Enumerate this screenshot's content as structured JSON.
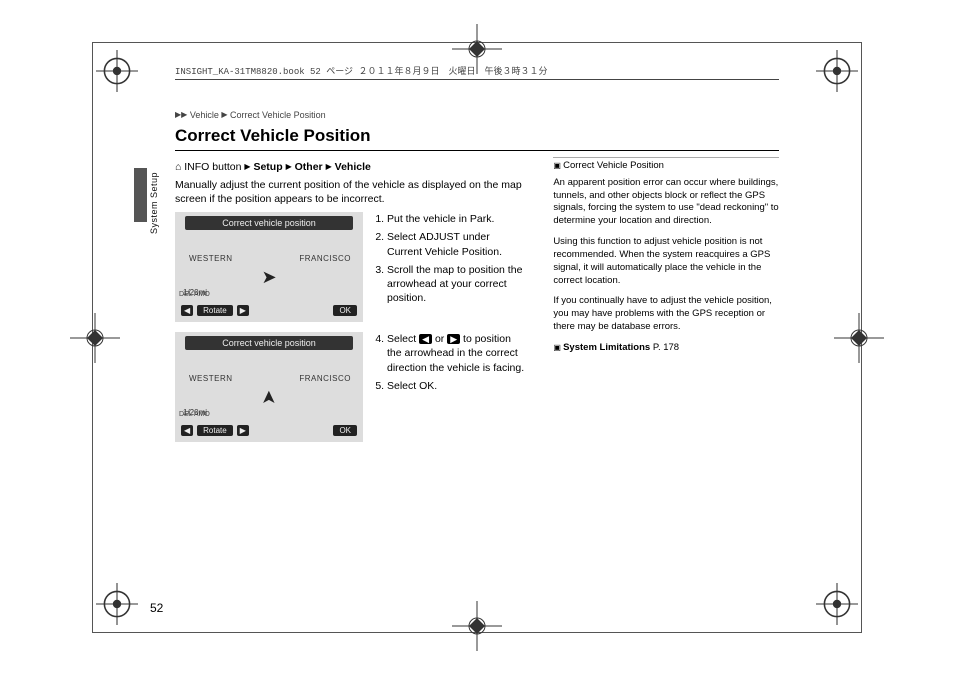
{
  "book_header": "INSIGHT_KA-31TM8820.book  52 ページ  ２０１１年８月９日　火曜日　午後３時３１分",
  "breadcrumb": {
    "arrow": "▶▶",
    "seg1": "Vehicle",
    "sep": "▶",
    "seg2": "Correct Vehicle Position"
  },
  "section_label": "System Setup",
  "title": "Correct Vehicle Position",
  "path": {
    "prefix_icon": "⌂",
    "prefix": "INFO button",
    "arrow": "▶",
    "s1": "Setup",
    "s2": "Other",
    "s3": "Vehicle"
  },
  "intro": "Manually adjust the current position of the vehicle as displayed on the map screen if the position appears to be incorrect.",
  "screenshot": {
    "title": "Correct vehicle position",
    "city_left": "WESTERN",
    "city_right": "FRANCISCO",
    "scale": "1/20mi",
    "del": "DEL AMO",
    "rotate": "Rotate",
    "ok": "OK"
  },
  "steps_a": {
    "s1": "Put the vehicle in Park.",
    "s2_a": "Select ",
    "s2_b": "ADJUST",
    "s2_c": " under ",
    "s2_d": "Current Vehicle Position",
    "s2_e": ".",
    "s3": "Scroll the map to position the arrowhead at your correct position."
  },
  "steps_b": {
    "s4_a": "Select ",
    "s4_b": " or ",
    "s4_c": " to position the arrowhead in the correct direction the vehicle is facing.",
    "s5_a": "Select ",
    "s5_b": "OK",
    "s5_c": "."
  },
  "right": {
    "heading": "Correct Vehicle Position",
    "p1": "An apparent position error can occur where buildings, tunnels, and other objects block or reflect the GPS signals, forcing the system to use \"dead reckoning\" to determine your location and direction.",
    "p2": "Using this function to adjust vehicle position is not recommended. When the system reacquires a GPS signal, it will automatically place the vehicle in the correct location.",
    "p3": "If you continually have to adjust the vehicle position, you may have problems with the GPS reception or there may be database errors.",
    "link": "System Limitations",
    "link_page": " P. 178"
  },
  "page_number": "52"
}
